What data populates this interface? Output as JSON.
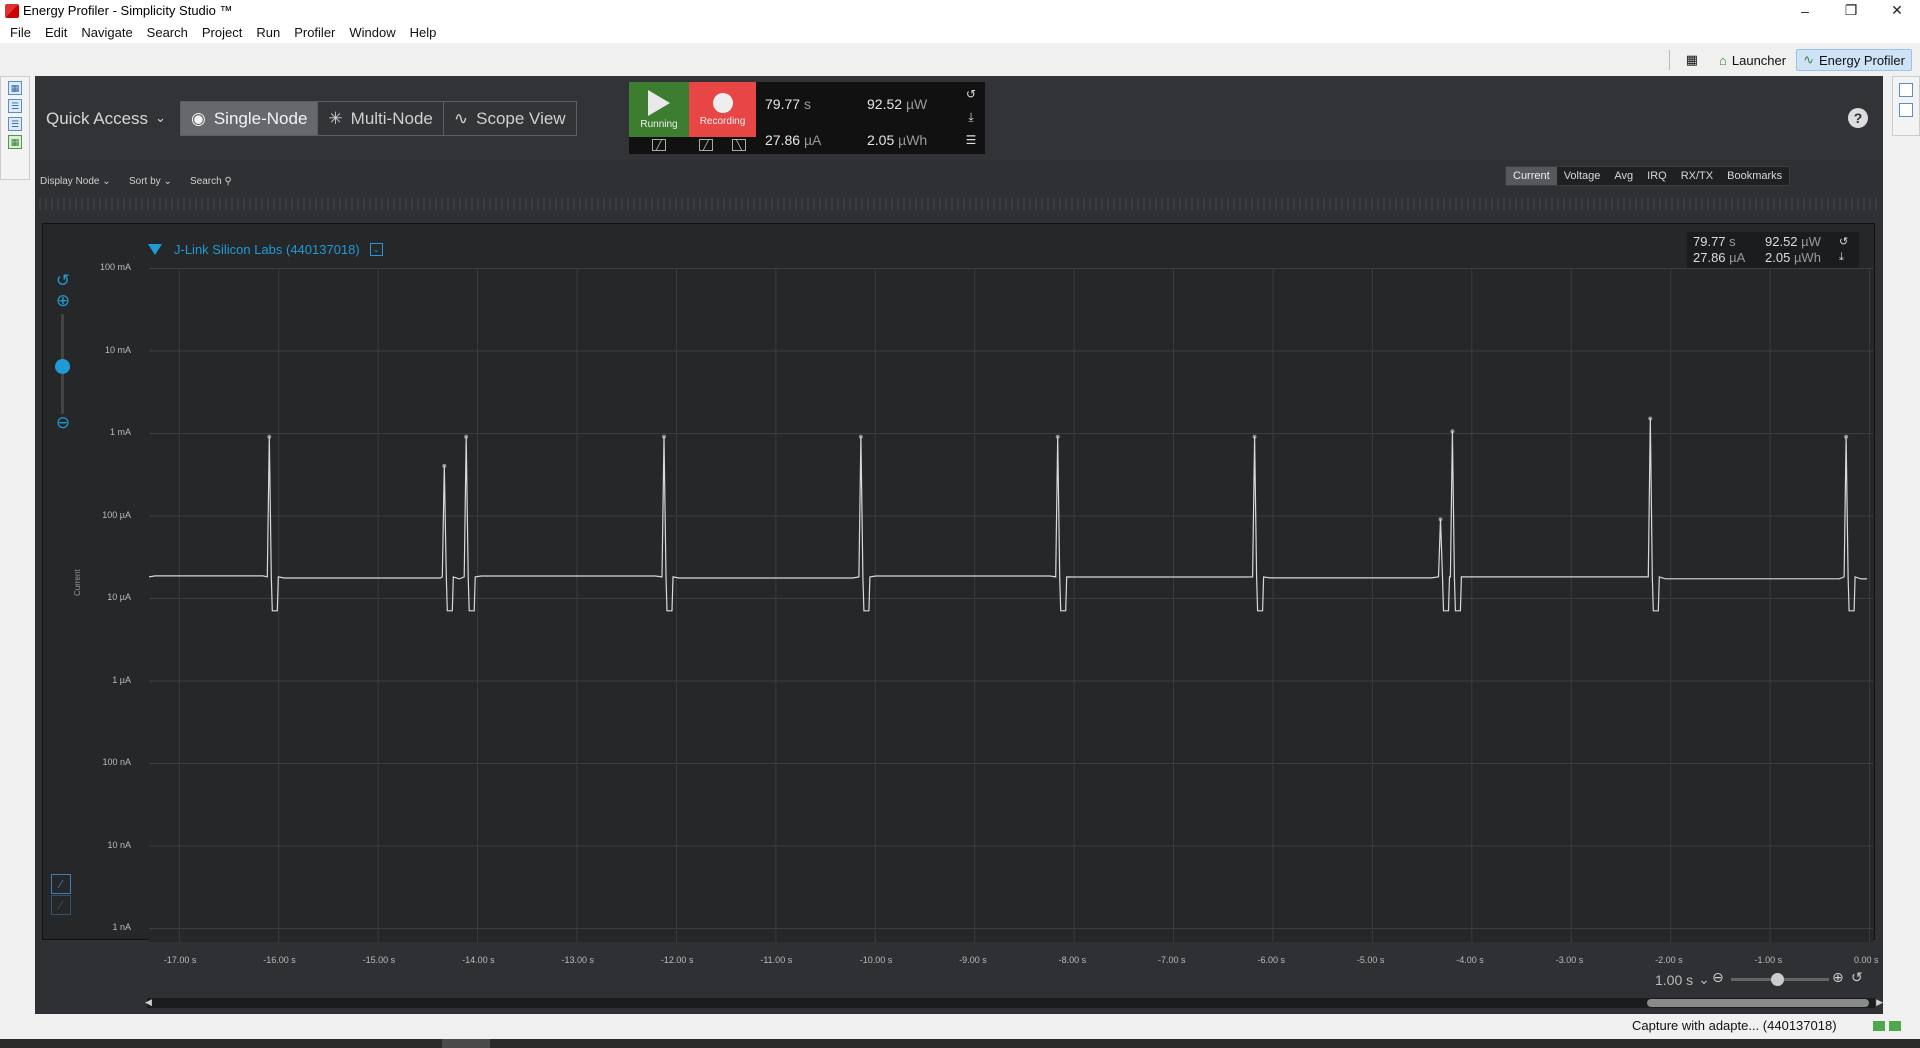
{
  "window": {
    "title": "Energy Profiler - Simplicity Studio ™"
  },
  "menu": [
    "File",
    "Edit",
    "Navigate",
    "Search",
    "Project",
    "Run",
    "Profiler",
    "Window",
    "Help"
  ],
  "perspectives": {
    "launcher": "Launcher",
    "energy_profiler": "Energy Profiler"
  },
  "toolbar": {
    "quick_access": "Quick Access",
    "modes": [
      "Single-Node",
      "Multi-Node",
      "Scope View"
    ],
    "running_label": "Running",
    "recording_label": "Recording",
    "time": {
      "value": "79.77",
      "unit": "s"
    },
    "current": {
      "value": "27.86",
      "unit": "µA"
    },
    "power": {
      "value": "92.52",
      "unit": "µW"
    },
    "energy": {
      "value": "2.05",
      "unit": "µWh"
    }
  },
  "filters": {
    "display_node": "Display Node",
    "sort_by": "Sort by",
    "search": "Search"
  },
  "tabs": [
    "Current",
    "Voltage",
    "Avg",
    "IRQ",
    "RX/TX",
    "Bookmarks"
  ],
  "active_tab": "Current",
  "device": {
    "name": "J-Link Silicon Labs (440137018)",
    "time": {
      "value": "79.77",
      "unit": "s"
    },
    "current": {
      "value": "27.86",
      "unit": "µA"
    },
    "power": {
      "value": "92.52",
      "unit": "µW"
    },
    "energy": {
      "value": "2.05",
      "unit": "µWh"
    }
  },
  "timescale": {
    "value": "1.00 s"
  },
  "status": {
    "capture": "Capture with adapte... (440137018)"
  },
  "colors": {
    "accent": "#1f9ad6",
    "running": "#3d7d2f",
    "recording": "#e84545",
    "trace": "#d9d9d9",
    "background": "#262729"
  },
  "chart_data": {
    "type": "line",
    "ylabel": "Current",
    "yscale": "log",
    "y_ticks": [
      "100 mA",
      "10 mA",
      "1 mA",
      "100 µA",
      "10 µA",
      "1 µA",
      "100 nA",
      "10 nA",
      "1 nA"
    ],
    "x_ticks": [
      "-17.00 s",
      "-16.00 s",
      "-15.00 s",
      "-14.00 s",
      "-13.00 s",
      "-12.00 s",
      "-11.00 s",
      "-10.00 s",
      "-9.00 s",
      "-8.00 s",
      "-7.00 s",
      "-6.00 s",
      "-5.00 s",
      "-4.00 s",
      "-3.00 s",
      "-2.00 s",
      "-1.00 s",
      "0.00 s"
    ],
    "xlim": [
      -17.3,
      0
    ],
    "baseline_ua": 18,
    "dip_ua": 7,
    "peaks": [
      {
        "t": -16.09,
        "ua": 900
      },
      {
        "t": -14.33,
        "ua": 400
      },
      {
        "t": -14.11,
        "ua": 900
      },
      {
        "t": -12.12,
        "ua": 900
      },
      {
        "t": -10.14,
        "ua": 900
      },
      {
        "t": -8.16,
        "ua": 900
      },
      {
        "t": -6.18,
        "ua": 900
      },
      {
        "t": -4.31,
        "ua": 90
      },
      {
        "t": -4.19,
        "ua": 1050
      },
      {
        "t": -2.2,
        "ua": 1500
      },
      {
        "t": -0.23,
        "ua": 900
      }
    ]
  }
}
